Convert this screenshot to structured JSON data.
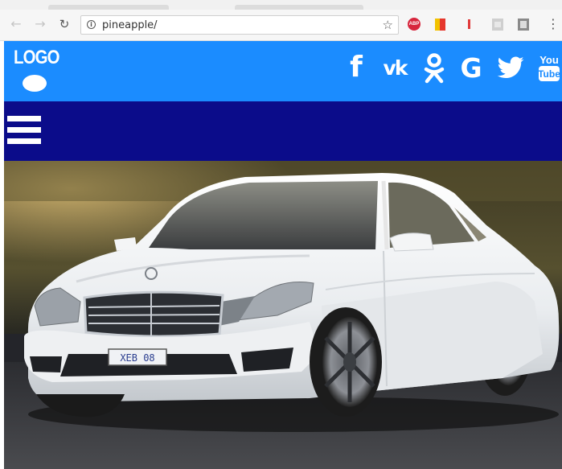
{
  "browser": {
    "url": "pineapple/",
    "nav_icons": {
      "back": "arrow-left-icon",
      "forward": "arrow-right-icon",
      "reload": "reload-icon"
    },
    "extensions": [
      "adblock-icon",
      "flag-extension-icon",
      "alert-extension-icon",
      "bars-extension-icon",
      "square-extension-icon"
    ],
    "menu_icon": "kebab-menu-icon"
  },
  "header": {
    "logo_text": "LOGO",
    "background": "#1b8cff",
    "social": [
      "facebook-icon",
      "vk-icon",
      "odnoklassniki-icon",
      "google-icon",
      "twitter-icon",
      "youtube-icon"
    ],
    "youtube_text_top": "You",
    "youtube_text_bottom": "Tube"
  },
  "nav": {
    "background": "#0b0c8a",
    "menu_icon": "hamburger-menu-icon"
  },
  "hero": {
    "subject": "white sedan car photo",
    "plate": "XEB 08"
  }
}
